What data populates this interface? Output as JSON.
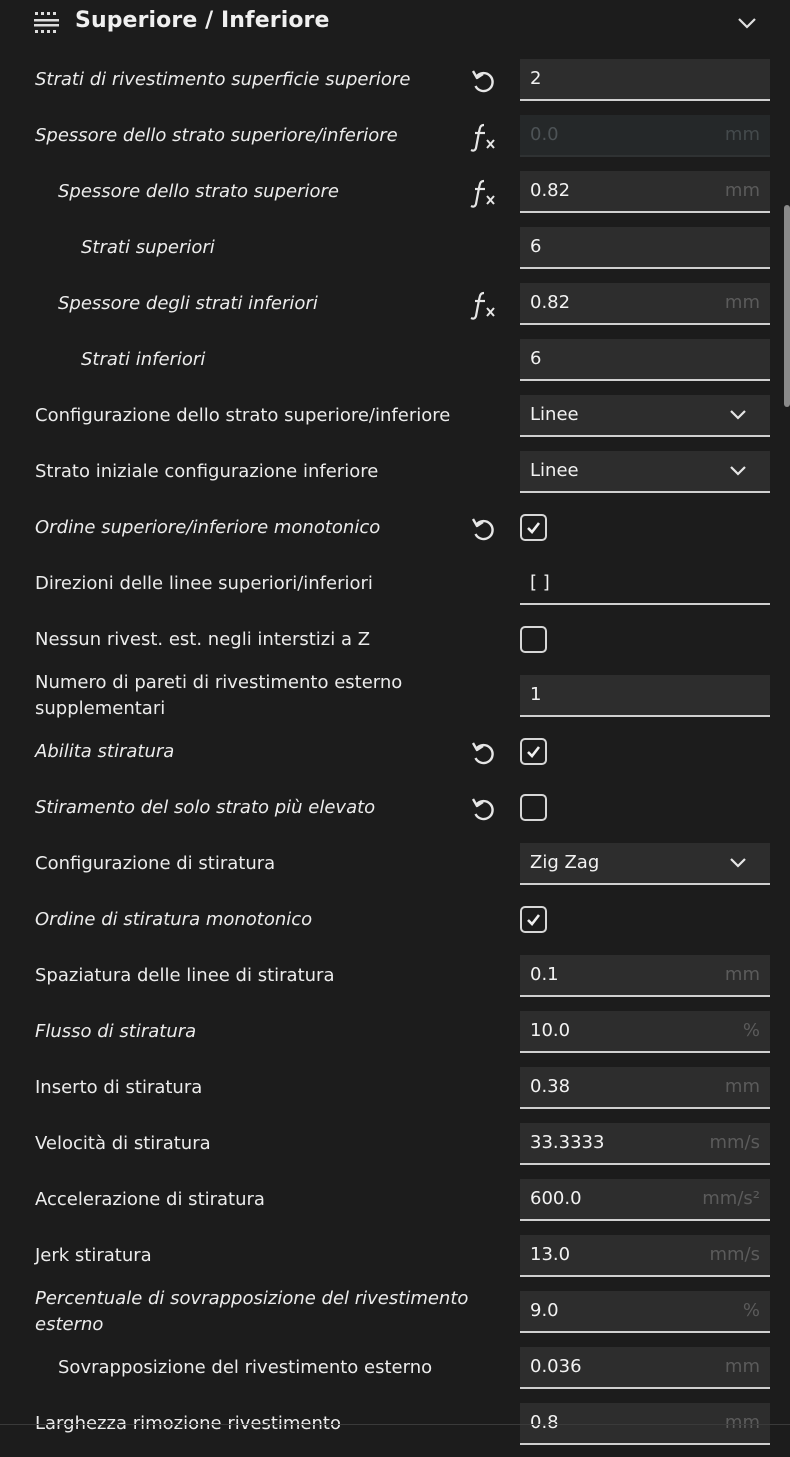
{
  "panel": {
    "title": "Superiore / Inferiore"
  },
  "rows": [
    {
      "label": "Strati di rivestimento superficie superiore",
      "value": "2",
      "unit": "",
      "icon": "reset"
    },
    {
      "label": "Spessore dello strato superiore/inferiore",
      "value": "0.0",
      "unit": "mm",
      "icon": "function"
    },
    {
      "label": "Spessore dello strato superiore",
      "value": "0.82",
      "unit": "mm",
      "icon": "function"
    },
    {
      "label": "Strati superiori",
      "value": "6",
      "unit": ""
    },
    {
      "label": "Spessore degli strati inferiori",
      "value": "0.82",
      "unit": "mm",
      "icon": "function"
    },
    {
      "label": "Strati inferiori",
      "value": "6",
      "unit": ""
    },
    {
      "label": "Configurazione dello strato superiore/inferiore",
      "value": "Linee"
    },
    {
      "label": "Strato iniziale configurazione inferiore",
      "value": "Linee"
    },
    {
      "label": "Ordine superiore/inferiore monotonico",
      "checked": true,
      "icon": "reset"
    },
    {
      "label": "Direzioni delle linee superiori/inferiori",
      "value": "[ ]"
    },
    {
      "label": "Nessun rivest. est. negli interstizi a Z",
      "checked": false
    },
    {
      "label": "Numero di pareti di rivestimento esterno supplementari",
      "value": "1",
      "unit": ""
    },
    {
      "label": "Abilita stiratura",
      "checked": true,
      "icon": "reset"
    },
    {
      "label": "Stiramento del solo strato più elevato",
      "checked": false,
      "icon": "reset"
    },
    {
      "label": "Configurazione di stiratura",
      "value": "Zig Zag"
    },
    {
      "label": "Ordine di stiratura monotonico",
      "checked": true
    },
    {
      "label": "Spaziatura delle linee di stiratura",
      "value": "0.1",
      "unit": "mm"
    },
    {
      "label": "Flusso di stiratura",
      "value": "10.0",
      "unit": "%"
    },
    {
      "label": "Inserto di stiratura",
      "value": "0.38",
      "unit": "mm"
    },
    {
      "label": "Velocità di stiratura",
      "value": "33.3333",
      "unit": "mm/s"
    },
    {
      "label": "Accelerazione di stiratura",
      "value": "600.0",
      "unit": "mm/s²"
    },
    {
      "label": "Jerk stiratura",
      "value": "13.0",
      "unit": "mm/s"
    },
    {
      "label": "Percentuale di sovrapposizione del rivestimento esterno",
      "value": "9.0",
      "unit": "%"
    },
    {
      "label": "Sovrapposizione del rivestimento esterno",
      "value": "0.036",
      "unit": "mm"
    },
    {
      "label": "Larghezza rimozione rivestimento",
      "value": "0.8",
      "unit": "mm"
    }
  ]
}
